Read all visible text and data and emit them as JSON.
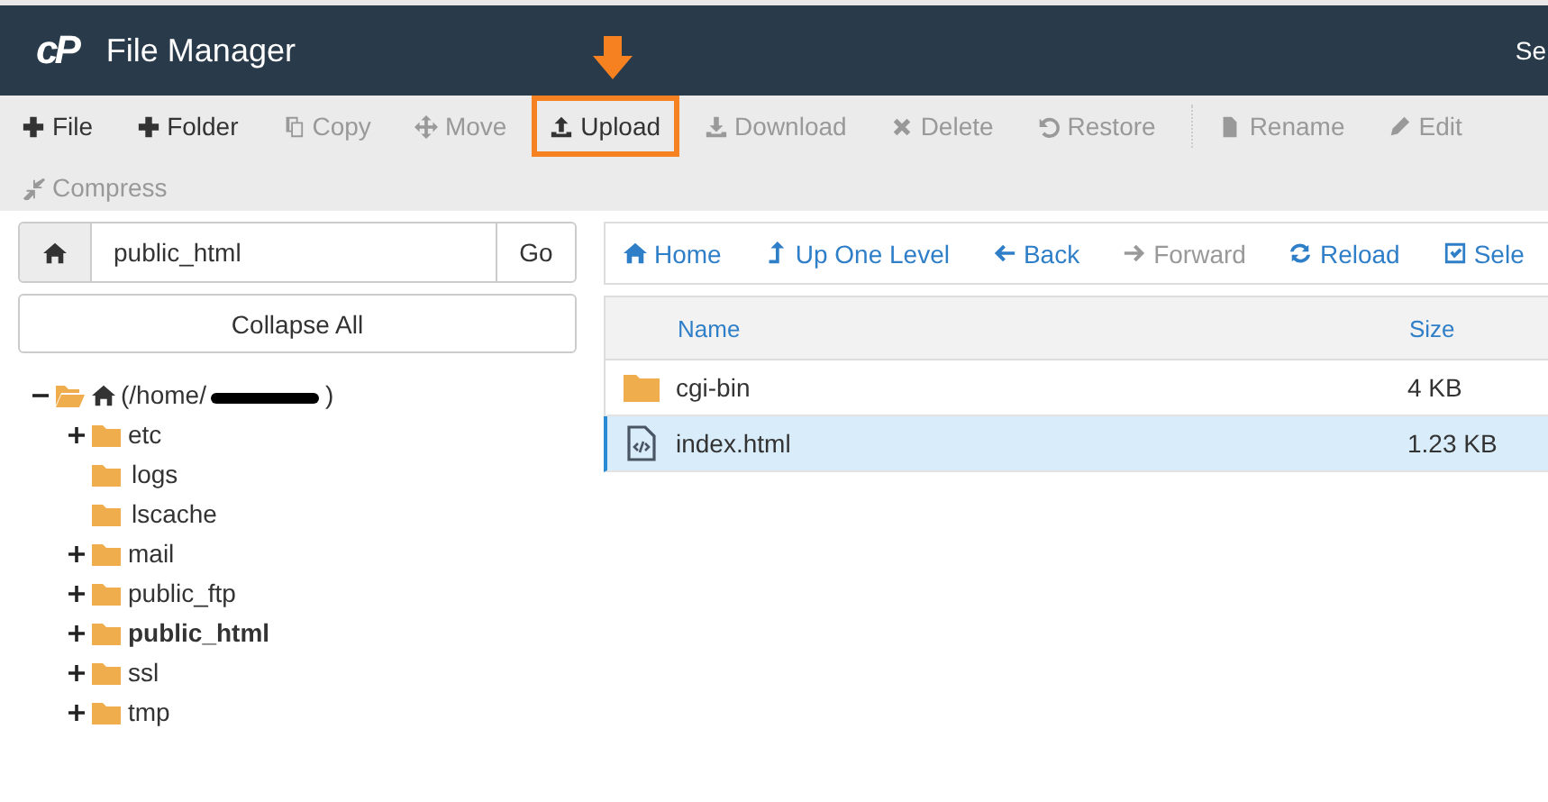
{
  "header": {
    "logo": "cP",
    "title": "File Manager",
    "right_text": "Se"
  },
  "toolbar": [
    {
      "label": "File",
      "disabled": false,
      "highlighted": false
    },
    {
      "label": "Folder",
      "disabled": false,
      "highlighted": false
    },
    {
      "label": "Copy",
      "disabled": true,
      "highlighted": false
    },
    {
      "label": "Move",
      "disabled": true,
      "highlighted": false
    },
    {
      "label": "Upload",
      "disabled": false,
      "highlighted": true
    },
    {
      "label": "Download",
      "disabled": true,
      "highlighted": false
    },
    {
      "label": "Delete",
      "disabled": true,
      "highlighted": false
    },
    {
      "label": "Restore",
      "disabled": true,
      "highlighted": false
    },
    {
      "label": "Rename",
      "disabled": true,
      "highlighted": false
    },
    {
      "label": "Edit",
      "disabled": true,
      "highlighted": false
    },
    {
      "label": "Compress",
      "disabled": true,
      "highlighted": false
    }
  ],
  "path_bar": {
    "value": "public_html",
    "go": "Go"
  },
  "collapse_all": "Collapse All",
  "tree": [
    {
      "label": "(/home/",
      "label_end": ")",
      "redacted": true,
      "expanded": true,
      "selected": false,
      "kind": "home",
      "children": [
        {
          "label": "etc",
          "expanded": false,
          "has_children": true,
          "selected": false,
          "kind": "folder"
        },
        {
          "label": "logs",
          "has_children": false,
          "selected": false,
          "kind": "folder"
        },
        {
          "label": "lscache",
          "has_children": false,
          "selected": false,
          "kind": "folder"
        },
        {
          "label": "mail",
          "expanded": false,
          "has_children": true,
          "selected": false,
          "kind": "folder"
        },
        {
          "label": "public_ftp",
          "expanded": false,
          "has_children": true,
          "selected": false,
          "kind": "folder"
        },
        {
          "label": "public_html",
          "expanded": false,
          "has_children": true,
          "selected": true,
          "kind": "folder"
        },
        {
          "label": "ssl",
          "expanded": false,
          "has_children": true,
          "selected": false,
          "kind": "folder"
        },
        {
          "label": "tmp",
          "expanded": false,
          "has_children": true,
          "selected": false,
          "kind": "folder"
        }
      ]
    }
  ],
  "nav": [
    {
      "label": "Home",
      "disabled": false
    },
    {
      "label": "Up One Level",
      "disabled": false
    },
    {
      "label": "Back",
      "disabled": false
    },
    {
      "label": "Forward",
      "disabled": true
    },
    {
      "label": "Reload",
      "disabled": false
    },
    {
      "label": "Sele",
      "disabled": false
    }
  ],
  "table": {
    "columns": [
      "Name",
      "Size"
    ],
    "rows": [
      {
        "kind": "folder",
        "name": "cgi-bin",
        "size": "4 KB",
        "selected": false
      },
      {
        "kind": "html",
        "name": "index.html",
        "size": "1.23 KB",
        "selected": true
      }
    ]
  }
}
